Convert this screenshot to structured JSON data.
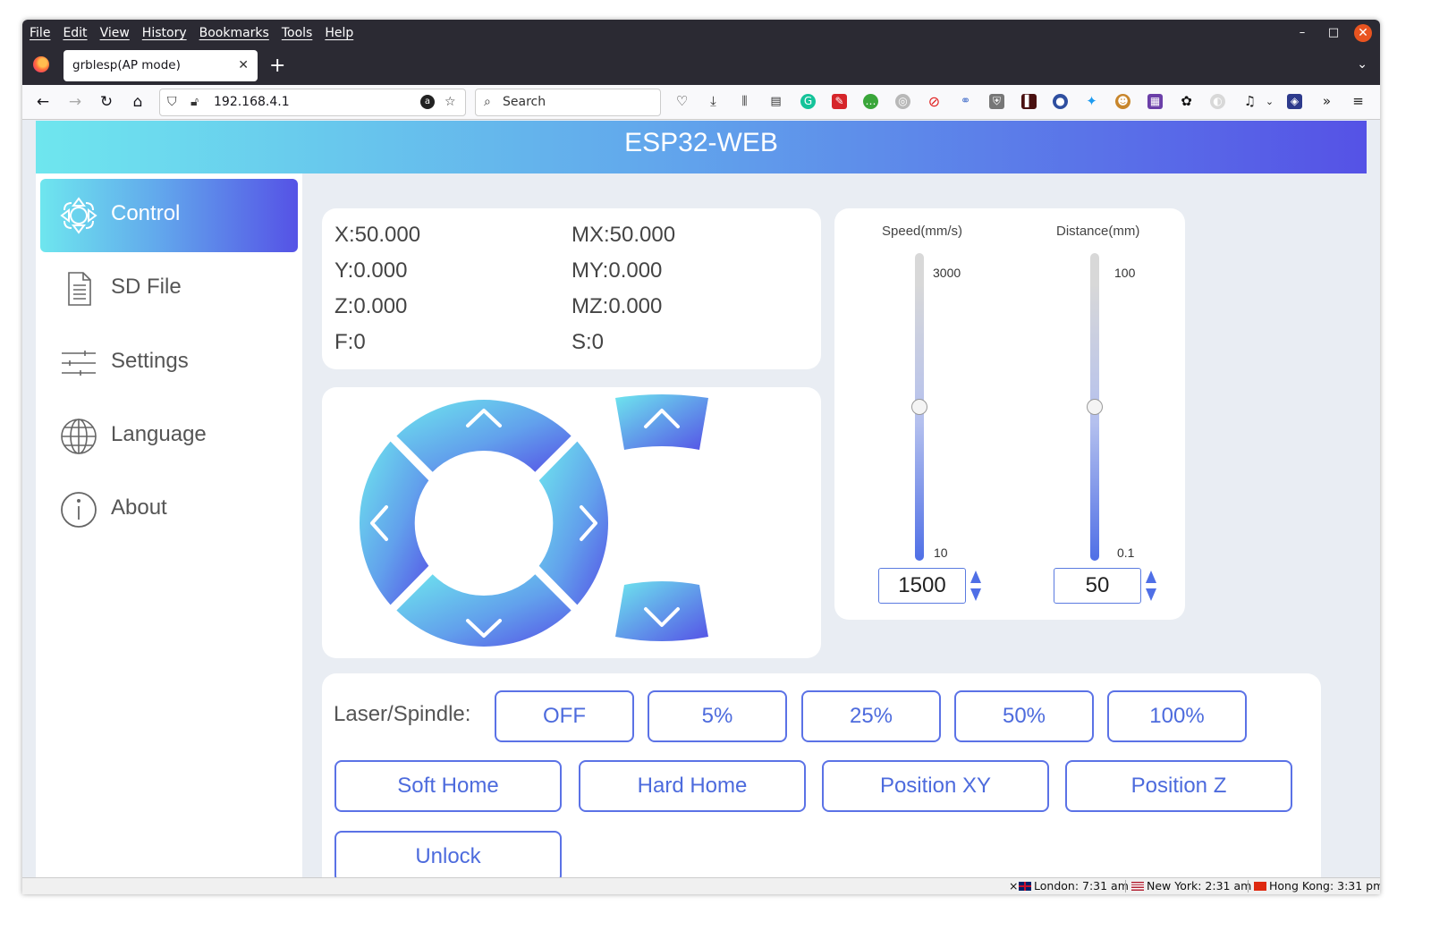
{
  "browser": {
    "menu": [
      "File",
      "Edit",
      "View",
      "History",
      "Bookmarks",
      "Tools",
      "Help"
    ],
    "tab_title": "grblesp(AP mode)",
    "url": "192.168.4.1",
    "search_placeholder": "Search"
  },
  "app": {
    "title": "ESP32-WEB",
    "sidebar": [
      {
        "label": "Control",
        "icon": "dpad-icon",
        "active": true
      },
      {
        "label": "SD File",
        "icon": "document-icon"
      },
      {
        "label": "Settings",
        "icon": "sliders-icon"
      },
      {
        "label": "Language",
        "icon": "globe-icon"
      },
      {
        "label": "About",
        "icon": "info-icon"
      }
    ],
    "coords": {
      "x": "X:50.000",
      "mx": "MX:50.000",
      "y": "Y:0.000",
      "my": "MY:0.000",
      "z": "Z:0.000",
      "mz": "MZ:0.000",
      "f": "F:0",
      "s": "S:0"
    },
    "speed": {
      "title": "Speed(mm/s)",
      "max": "3000",
      "min": "10",
      "value": "1500",
      "level": 0.5
    },
    "distance": {
      "title": "Distance(mm)",
      "max": "100",
      "min": "0.1",
      "value": "50",
      "level": 0.5
    },
    "laser": {
      "label": "Laser/Spindle:",
      "buttons": [
        "OFF",
        "5%",
        "25%",
        "50%",
        "100%"
      ]
    },
    "actions": [
      "Soft Home",
      "Hard Home",
      "Position XY",
      "Position Z",
      "Unlock"
    ]
  },
  "statusbar": {
    "clocks": [
      {
        "label": "London: 7:31 am"
      },
      {
        "label": "New York: 2:31 am"
      },
      {
        "label": "Hong Kong: 3:31 pm"
      }
    ],
    "close_glyph": "×"
  },
  "colors": {
    "accent_start": "#6ee6ee",
    "accent_end": "#5552e6",
    "button_text": "#4d6bdd"
  }
}
